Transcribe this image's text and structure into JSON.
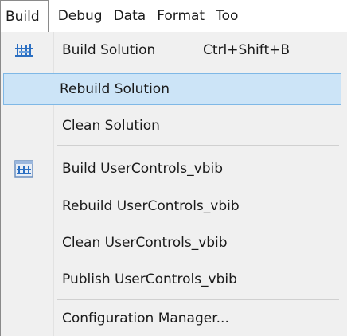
{
  "menubar": {
    "items": [
      {
        "label": "Build"
      },
      {
        "label": "Debug"
      },
      {
        "label": "Data"
      },
      {
        "label": "Format"
      },
      {
        "label": "Too"
      }
    ]
  },
  "build_menu": {
    "items": [
      {
        "label": "Build Solution",
        "shortcut": "Ctrl+Shift+B",
        "icon": "build-solution-icon"
      },
      {
        "label": "Rebuild Solution",
        "highlighted": true
      },
      {
        "label": "Clean Solution"
      },
      {
        "label": "Build UserControls_vbib",
        "icon": "build-project-icon"
      },
      {
        "label": "Rebuild UserControls_vbib"
      },
      {
        "label": "Clean UserControls_vbib"
      },
      {
        "label": "Publish UserControls_vbib"
      },
      {
        "label": "Configuration Manager..."
      }
    ]
  },
  "colors": {
    "highlight_fill": "#cce4f7",
    "highlight_border": "#7fb8e6",
    "menu_background": "#f0f0f0",
    "icon_blue": "#2b6fc2"
  }
}
